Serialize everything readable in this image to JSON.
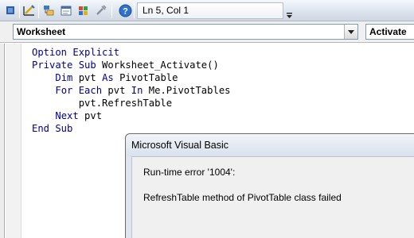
{
  "toolbar": {
    "buttons": [
      {
        "icon": "view-excel-icon"
      },
      {
        "icon": "design-mode-icon"
      },
      {
        "icon": "project-explorer-icon"
      },
      {
        "icon": "properties-window-icon"
      },
      {
        "icon": "object-browser-icon"
      },
      {
        "icon": "toolbox-icon"
      },
      {
        "icon": "help-icon"
      }
    ],
    "position": "Ln 5, Col 1"
  },
  "object_selector": {
    "value": "Worksheet"
  },
  "procedure_selector": {
    "value": "Activate"
  },
  "code": {
    "lines": [
      {
        "indent": "",
        "kw": "Option Explicit",
        "rest": ""
      },
      {
        "indent": "",
        "kw": "Private Sub",
        "rest": " Worksheet_Activate()"
      },
      {
        "indent": "    ",
        "kw": "Dim",
        "rest": " pvt ",
        "kw2": "As",
        "rest2": " PivotTable"
      },
      {
        "indent": "    ",
        "kw": "For Each",
        "rest": " pvt ",
        "kw2": "In",
        "rest2": " Me.PivotTables"
      },
      {
        "indent": "        ",
        "kw": "",
        "rest": "pvt.RefreshTable"
      },
      {
        "indent": "    ",
        "kw": "Next",
        "rest": " pvt"
      },
      {
        "indent": "",
        "kw": "End Sub",
        "rest": ""
      }
    ]
  },
  "dialog": {
    "title": "Microsoft Visual Basic",
    "error_code": "Run-time error '1004':",
    "message": "RefreshTable method of PivotTable class failed"
  }
}
